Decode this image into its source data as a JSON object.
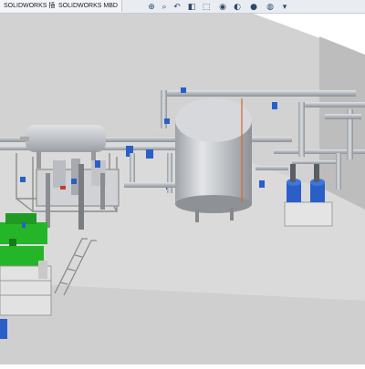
{
  "tabs": [
    {
      "label": "SOLIDWORKS 插件"
    },
    {
      "label": "SOLIDWORKS MBD"
    }
  ],
  "heads_up_toolbar": [
    {
      "icon": "zoom-to-fit-icon",
      "glyph": "⊕"
    },
    {
      "icon": "zoom-area-icon",
      "glyph": "⌕"
    },
    {
      "icon": "previous-view-icon",
      "glyph": "↶"
    },
    {
      "icon": "section-view-icon",
      "glyph": "◧"
    },
    {
      "icon": "view-orientation-icon",
      "glyph": "⬚"
    },
    {
      "icon": "display-style-icon",
      "glyph": "◉"
    },
    {
      "icon": "hide-show-items-icon",
      "glyph": "◐"
    },
    {
      "icon": "edit-appearance-icon",
      "glyph": "●"
    },
    {
      "icon": "apply-scene-icon",
      "glyph": "◍"
    },
    {
      "icon": "view-settings-icon",
      "glyph": "▾"
    }
  ],
  "colors": {
    "floor": "#d9d9d9",
    "wall": "#cdcdcd",
    "pipe": "#b8bcc2",
    "tank": "#c9cbcf",
    "pump_blue": "#2a5fc8",
    "motor_green": "#25b528",
    "accent_orange": "#d9652a"
  }
}
